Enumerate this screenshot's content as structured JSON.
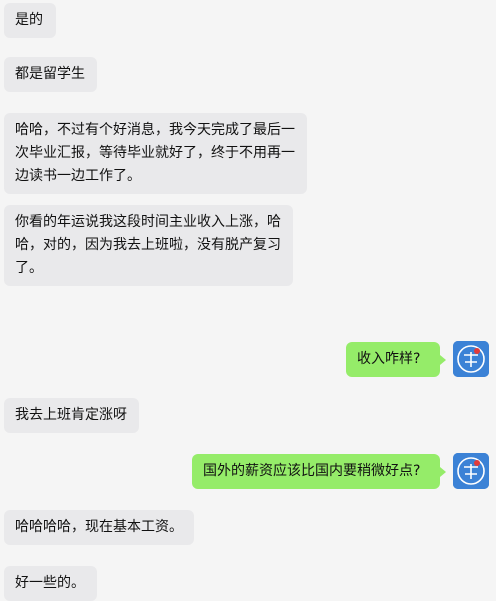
{
  "messages": [
    {
      "side": "in",
      "text": "是的"
    },
    {
      "side": "in",
      "text": "都是留学生"
    },
    {
      "side": "in",
      "text": "哈哈，不过有个好消息，我今天完成了最后一次毕业汇报，等待毕业就好了，终于不用再一边读书一边工作了。"
    },
    {
      "side": "in",
      "text": "你看的年运说我这段时间主业收入上涨，哈哈，对的，因为我去上班啦，没有脱产复习了。"
    },
    {
      "side": "out",
      "text": "收入咋样?"
    },
    {
      "side": "in",
      "text": "我去上班肯定涨呀"
    },
    {
      "side": "out",
      "text": "国外的薪资应该比国内要稍微好点?"
    },
    {
      "side": "in",
      "text": "哈哈哈哈，现在基本工资。"
    },
    {
      "side": "in",
      "text": "好一些的。"
    }
  ],
  "colors": {
    "background": "#f5f5f5",
    "incoming_bubble": "#e9e9eb",
    "outgoing_bubble": "#95ec69",
    "avatar": "#3b82d6"
  },
  "icons": {
    "avatar": "user-avatar-icon"
  }
}
